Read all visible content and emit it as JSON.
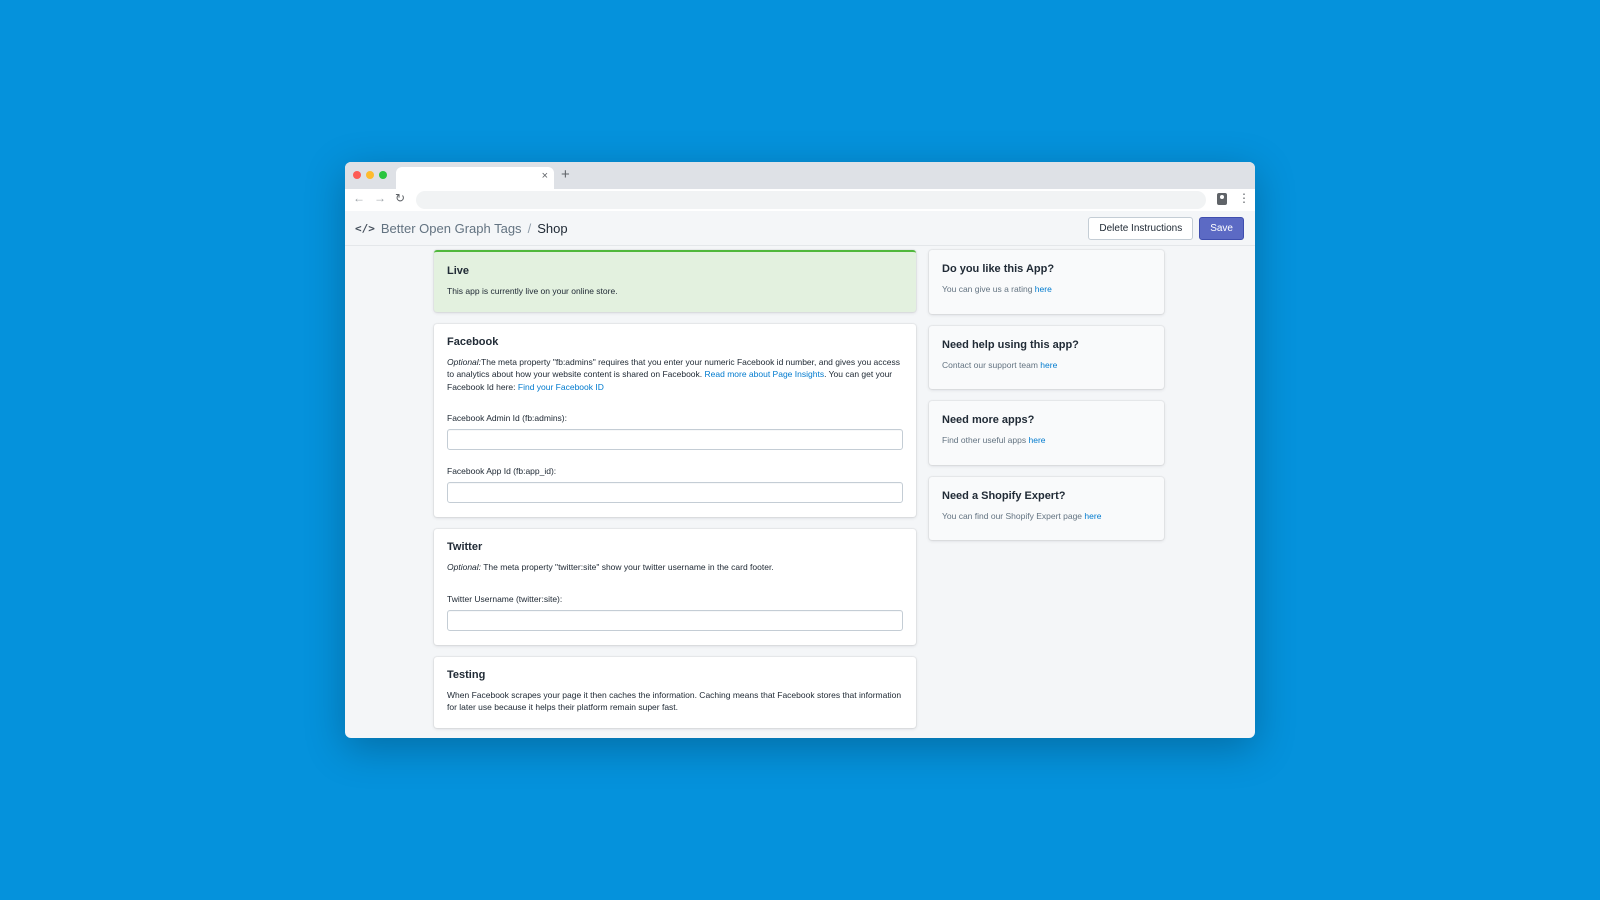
{
  "browser": {
    "tab_title": "",
    "close_tab_glyph": "×",
    "new_tab_glyph": "+",
    "back_glyph": "←",
    "forward_glyph": "→",
    "reload_glyph": "↻",
    "menu_glyph": "⋮",
    "url": ""
  },
  "header": {
    "app_icon": "code-icon",
    "app_icon_glyph": "</>",
    "app_name": "Better Open Graph Tags",
    "separator": "/",
    "current_page": "Shop",
    "delete_button": "Delete Instructions",
    "save_button": "Save",
    "primary_color": "#5c6ac4"
  },
  "live": {
    "title": "Live",
    "text": "This app is currently live on your online store.",
    "status_color": "#50b83c"
  },
  "facebook": {
    "title": "Facebook",
    "optional_label": "Optional:",
    "description": "The meta property \"fb:admins\" requires that you enter your numeric Facebook id number, and gives you access to analytics about how your website content is shared on Facebook. ",
    "read_more_link": "Read more about Page Insights",
    "get_id_text": ". You can get your Facebook Id here: ",
    "find_id_link": "Find your Facebook ID",
    "admin_id_label": "Facebook Admin Id (fb:admins):",
    "admin_id_value": "",
    "app_id_label": "Facebook App Id (fb:app_id):",
    "app_id_value": ""
  },
  "twitter": {
    "title": "Twitter",
    "optional_label": "Optional:",
    "description": " The meta property \"twitter:site\" show your twitter username in the card footer.",
    "username_label": "Twitter Username (twitter:site):",
    "username_value": ""
  },
  "testing": {
    "title": "Testing",
    "description": "When Facebook scrapes your page it then caches the information. Caching means that Facebook stores that information for later use because it helps their platform remain super fast."
  },
  "sidebar": [
    {
      "title": "Do you like this App?",
      "text": "You can give us a rating ",
      "link": "here"
    },
    {
      "title": "Need help using this app?",
      "text": "Contact our support team ",
      "link": "here"
    },
    {
      "title": "Need more apps?",
      "text": "Find other useful apps ",
      "link": "here"
    },
    {
      "title": "Need a Shopify Expert?",
      "text": "You can find our Shopify Expert page ",
      "link": "here"
    }
  ]
}
